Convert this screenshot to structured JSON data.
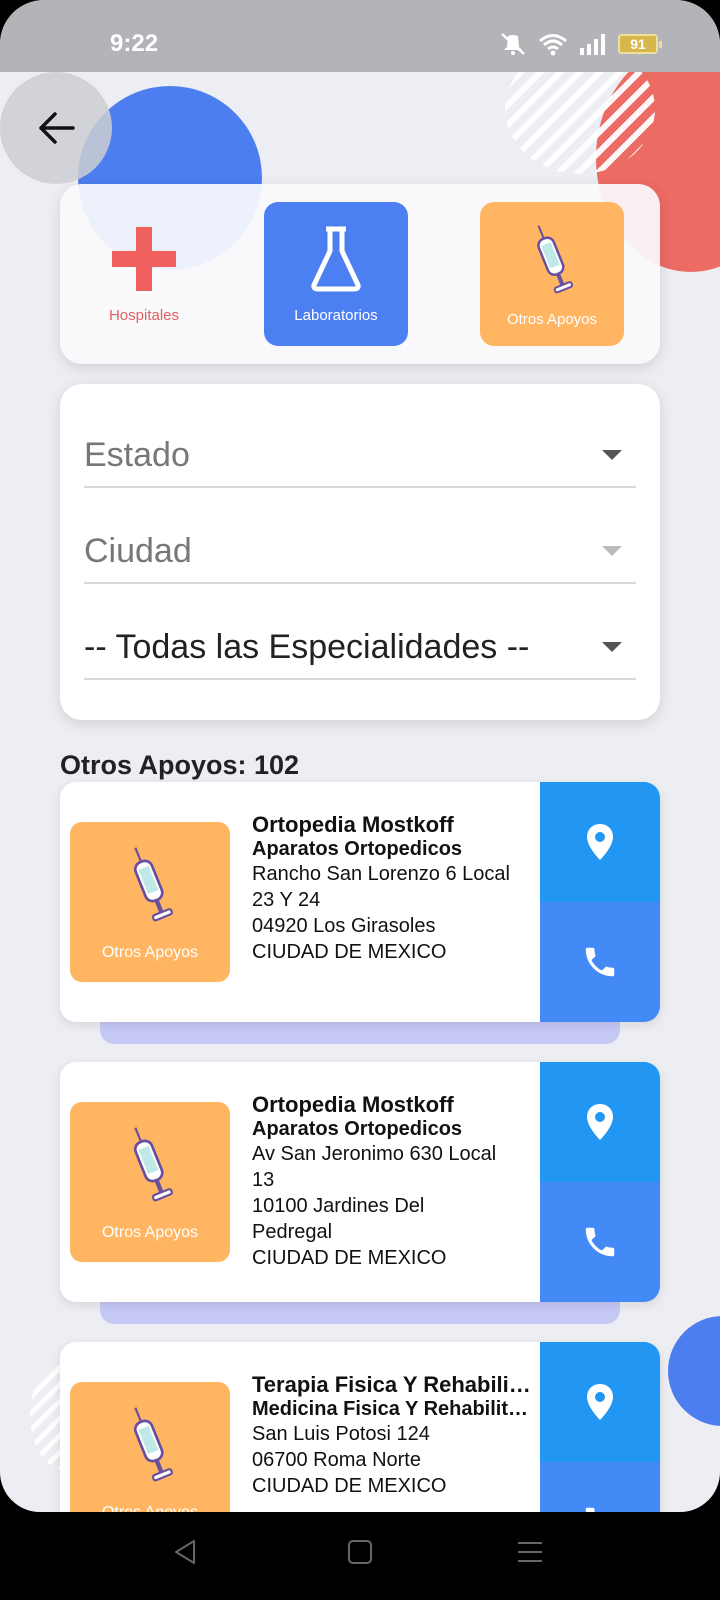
{
  "status_bar": {
    "time": "9:22",
    "battery": "91"
  },
  "categories": [
    {
      "id": "hospitales",
      "label": "Hospitales"
    },
    {
      "id": "laboratorios",
      "label": "Laboratorios"
    },
    {
      "id": "otros",
      "label": "Otros Apoyos"
    }
  ],
  "filters": {
    "estado": "Estado",
    "ciudad": "Ciudad",
    "especialidad": "-- Todas las Especialidades --"
  },
  "results_title": "Otros Apoyos: 102",
  "results": [
    {
      "thumb_label": "Otros Apoyos",
      "name": "Ortopedia Mostkoff",
      "specialty": "Aparatos Ortopedicos",
      "lines": [
        "Rancho San Lorenzo 6 Local",
        "23 Y 24",
        "04920 Los Girasoles",
        "CIUDAD DE MEXICO"
      ]
    },
    {
      "thumb_label": "Otros Apoyos",
      "name": "Ortopedia Mostkoff",
      "specialty": "Aparatos Ortopedicos",
      "lines": [
        "Av San Jeronimo 630  Local",
        "13",
        "10100 Jardines Del",
        "Pedregal",
        "CIUDAD DE MEXICO"
      ]
    },
    {
      "thumb_label": "Otros Apoyos",
      "name": "Terapia Fisica Y Rehabilitacion",
      "specialty": "Medicina Fisica Y Rehabilitacion",
      "lines": [
        "San Luis Potosi 124",
        "06700 Roma Norte",
        "CIUDAD DE MEXICO"
      ]
    }
  ],
  "colors": {
    "accent_blue": "#4c80f2",
    "accent_orange": "#ffb562",
    "accent_red": "#ec6b64",
    "map_button": "#2196f3",
    "call_button": "#448af7"
  }
}
